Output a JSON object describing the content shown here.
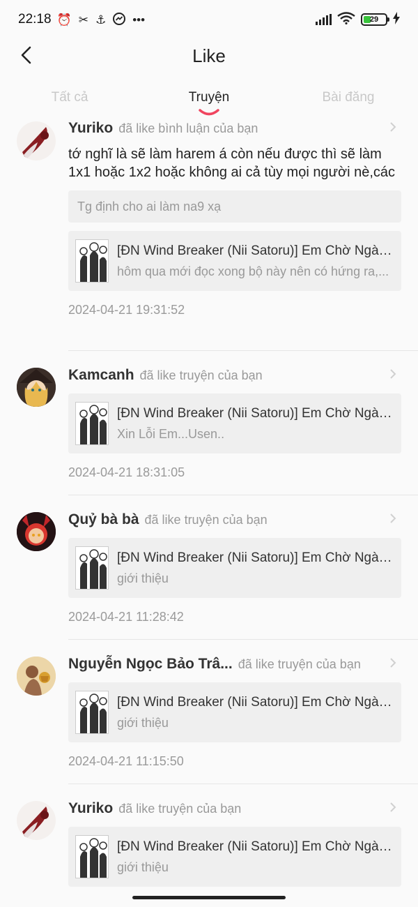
{
  "status_bar": {
    "time": "22:18",
    "battery_level": "29",
    "icons_left": [
      "alarm-icon",
      "capcut-icon",
      "anchor-icon",
      "messenger-icon",
      "more-dots-icon"
    ],
    "icons_right": [
      "signal-icon",
      "wifi-icon",
      "battery-icon",
      "charging-icon"
    ]
  },
  "header": {
    "title": "Like"
  },
  "tabs": [
    {
      "label": "Tất cả",
      "active": false
    },
    {
      "label": "Truyện",
      "active": true
    },
    {
      "label": "Bài đăng",
      "active": false
    }
  ],
  "colors": {
    "accent": "#f0455f",
    "battery_green": "#39c43c",
    "muted_text": "#999999"
  },
  "items": [
    {
      "user": "Yuriko",
      "action": "đã like bình luận của bạn",
      "comment": "tớ nghĩ là sẽ làm harem á còn nếu được thì sẽ làm 1x1 hoặc 1x2 hoặc không ai cả tùy mọi người nè,các",
      "quote": "Tg định cho ai làm na9 xạ",
      "story_title": "[ĐN Wind Breaker (Nii Satoru)] Em Chờ Ngày A...",
      "story_sub": "hôm qua mới đọc xong bộ này nên có hứng ra,...",
      "time": "2024-04-21 19:31:52"
    },
    {
      "user": "Kamcanh",
      "action": "đã like truyện của bạn",
      "story_title": "[ĐN Wind Breaker (Nii Satoru)] Em Chờ Ngày A...",
      "story_sub": "Xin Lỗi Em...Usen..",
      "time": "2024-04-21 18:31:05"
    },
    {
      "user": "Quỷ bà bà",
      "action": "đã like truyện của bạn",
      "story_title": "[ĐN Wind Breaker (Nii Satoru)] Em Chờ Ngày A...",
      "story_sub": "giới thiệu",
      "time": "2024-04-21 11:28:42"
    },
    {
      "user": "Nguyễn Ngọc Bảo Trâ...",
      "action": "đã like truyện của bạn",
      "story_title": "[ĐN Wind Breaker (Nii Satoru)] Em Chờ Ngày A...",
      "story_sub": "giới thiệu",
      "time": "2024-04-21 11:15:50"
    },
    {
      "user": "Yuriko",
      "action": "đã like truyện của bạn",
      "story_title": "[ĐN Wind Breaker (Nii Satoru)] Em Chờ Ngày A...",
      "story_sub": "giới thiệu"
    }
  ]
}
